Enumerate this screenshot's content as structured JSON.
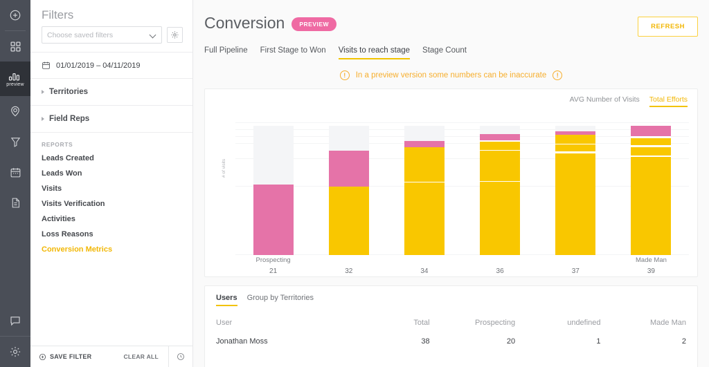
{
  "rail": {
    "items": [
      {
        "name": "add-icon",
        "glyph": "plus-circle"
      },
      {
        "name": "dashboard-icon",
        "glyph": "grid"
      },
      {
        "name": "analytics-icon",
        "glyph": "bars",
        "caption": "preview",
        "active": true
      },
      {
        "name": "location-icon",
        "glyph": "pin"
      },
      {
        "name": "funnel-icon",
        "glyph": "funnel"
      },
      {
        "name": "calendar-icon",
        "glyph": "calendar"
      },
      {
        "name": "document-icon",
        "glyph": "doc"
      }
    ],
    "bottom": [
      {
        "name": "chat-icon",
        "glyph": "chat"
      },
      {
        "name": "settings-icon",
        "glyph": "gear"
      }
    ]
  },
  "filters": {
    "title": "Filters",
    "saved_filters_placeholder": "Choose saved filters",
    "settings_icon": "gear-icon",
    "date_range": "01/01/2019 – 04/11/2019",
    "date_icon": "calendar-icon",
    "groups": [
      {
        "label": "Territories"
      },
      {
        "label": "Field Reps"
      }
    ],
    "reports_header": "REPORTS",
    "reports": [
      {
        "label": "Leads Created",
        "active": false
      },
      {
        "label": "Leads Won",
        "active": false
      },
      {
        "label": "Visits",
        "active": false
      },
      {
        "label": "Visits Verification",
        "active": false
      },
      {
        "label": "Activities",
        "active": false
      },
      {
        "label": "Loss Reasons",
        "active": false
      },
      {
        "label": "Conversion Metrics",
        "active": true
      }
    ],
    "footer": {
      "save_filter": "SAVE FILTER",
      "save_icon": "plus-circle-icon",
      "clear_all": "CLEAR ALL",
      "history_icon": "clock-icon"
    }
  },
  "header": {
    "title": "Conversion",
    "badge": "PREVIEW",
    "refresh_label": "REFRESH",
    "tabs": [
      {
        "label": "Full Pipeline",
        "active": false
      },
      {
        "label": "First Stage to Won",
        "active": false
      },
      {
        "label": "Visits to reach stage",
        "active": true
      },
      {
        "label": "Stage Count",
        "active": false
      }
    ],
    "notice": "In a preview version some numbers can be inaccurate",
    "notice_icon": "exclamation-circle-icon"
  },
  "chart_card": {
    "legend": [
      {
        "label": "AVG Number of Visits",
        "active": false
      },
      {
        "label": "Total Efforts",
        "active": true
      }
    ]
  },
  "chart_data": {
    "type": "bar",
    "subtype": "stacked",
    "title": "",
    "xlabel": "",
    "ylabel": "# of visits",
    "grid": true,
    "legend_position": "top-right",
    "categories": [
      "21",
      "32",
      "34",
      "36",
      "37",
      "39"
    ],
    "category_names": [
      "Prospecting",
      "",
      "",
      "",
      "",
      "Made Man"
    ],
    "ylim": [
      0,
      155
    ],
    "colors": {
      "empty": "#f4f5f7",
      "pink": "#e573a8",
      "yellow": "#f9c700",
      "gap": "#ffffff"
    },
    "bars": [
      {
        "category": "21",
        "total": 145,
        "segments": [
          {
            "type": "empty",
            "color": "#f4f5f7",
            "value": 66
          },
          {
            "type": "pink",
            "color": "#e573a8",
            "value": 79
          }
        ]
      },
      {
        "category": "32",
        "total": 145,
        "segments": [
          {
            "type": "empty",
            "color": "#f4f5f7",
            "value": 28
          },
          {
            "type": "pink",
            "color": "#e573a8",
            "value": 40
          },
          {
            "type": "yellow",
            "color": "#f9c700",
            "value": 77
          }
        ]
      },
      {
        "category": "34",
        "total": 145,
        "segments": [
          {
            "type": "empty",
            "color": "#f4f5f7",
            "value": 17
          },
          {
            "type": "pink",
            "color": "#e573a8",
            "value": 7
          },
          {
            "type": "yellow",
            "color": "#f9c700",
            "value": 39
          },
          {
            "type": "gap",
            "color": "#ffffff",
            "value": 1
          },
          {
            "type": "yellow",
            "color": "#f9c700",
            "value": 81
          }
        ]
      },
      {
        "category": "36",
        "total": 145,
        "segments": [
          {
            "type": "empty",
            "color": "#f4f5f7",
            "value": 9
          },
          {
            "type": "pink",
            "color": "#e573a8",
            "value": 7
          },
          {
            "type": "gap",
            "color": "#ffffff",
            "value": 2
          },
          {
            "type": "yellow",
            "color": "#f9c700",
            "value": 9
          },
          {
            "type": "gap",
            "color": "#ffffff",
            "value": 1
          },
          {
            "type": "yellow",
            "color": "#f9c700",
            "value": 34
          },
          {
            "type": "gap",
            "color": "#ffffff",
            "value": 1
          },
          {
            "type": "yellow",
            "color": "#f9c700",
            "value": 82
          }
        ]
      },
      {
        "category": "37",
        "total": 145,
        "segments": [
          {
            "type": "empty",
            "color": "#f4f5f7",
            "value": 6
          },
          {
            "type": "pink",
            "color": "#e573a8",
            "value": 4
          },
          {
            "type": "yellow",
            "color": "#f9c700",
            "value": 10
          },
          {
            "type": "gap",
            "color": "#ffffff",
            "value": 1
          },
          {
            "type": "yellow",
            "color": "#f9c700",
            "value": 8
          },
          {
            "type": "gap",
            "color": "#ffffff",
            "value": 2
          },
          {
            "type": "yellow",
            "color": "#f9c700",
            "value": 114
          }
        ]
      },
      {
        "category": "39",
        "total": 145,
        "segments": [
          {
            "type": "pink",
            "color": "#e573a8",
            "value": 12
          },
          {
            "type": "gap",
            "color": "#ffffff",
            "value": 2
          },
          {
            "type": "yellow",
            "color": "#f9c700",
            "value": 8
          },
          {
            "type": "gap",
            "color": "#ffffff",
            "value": 2
          },
          {
            "type": "yellow",
            "color": "#f9c700",
            "value": 9
          },
          {
            "type": "gap",
            "color": "#ffffff",
            "value": 2
          },
          {
            "type": "yellow",
            "color": "#f9c700",
            "value": 110
          }
        ]
      }
    ]
  },
  "table_card": {
    "tabs": [
      {
        "label": "Users",
        "active": true
      },
      {
        "label": "Group by Territories",
        "active": false
      }
    ],
    "columns": [
      "User",
      "Total",
      "Prospecting",
      "undefined",
      "Made Man"
    ],
    "rows": [
      {
        "cells": [
          "Jonathan Moss",
          "38",
          "20",
          "1",
          "2"
        ]
      }
    ]
  }
}
